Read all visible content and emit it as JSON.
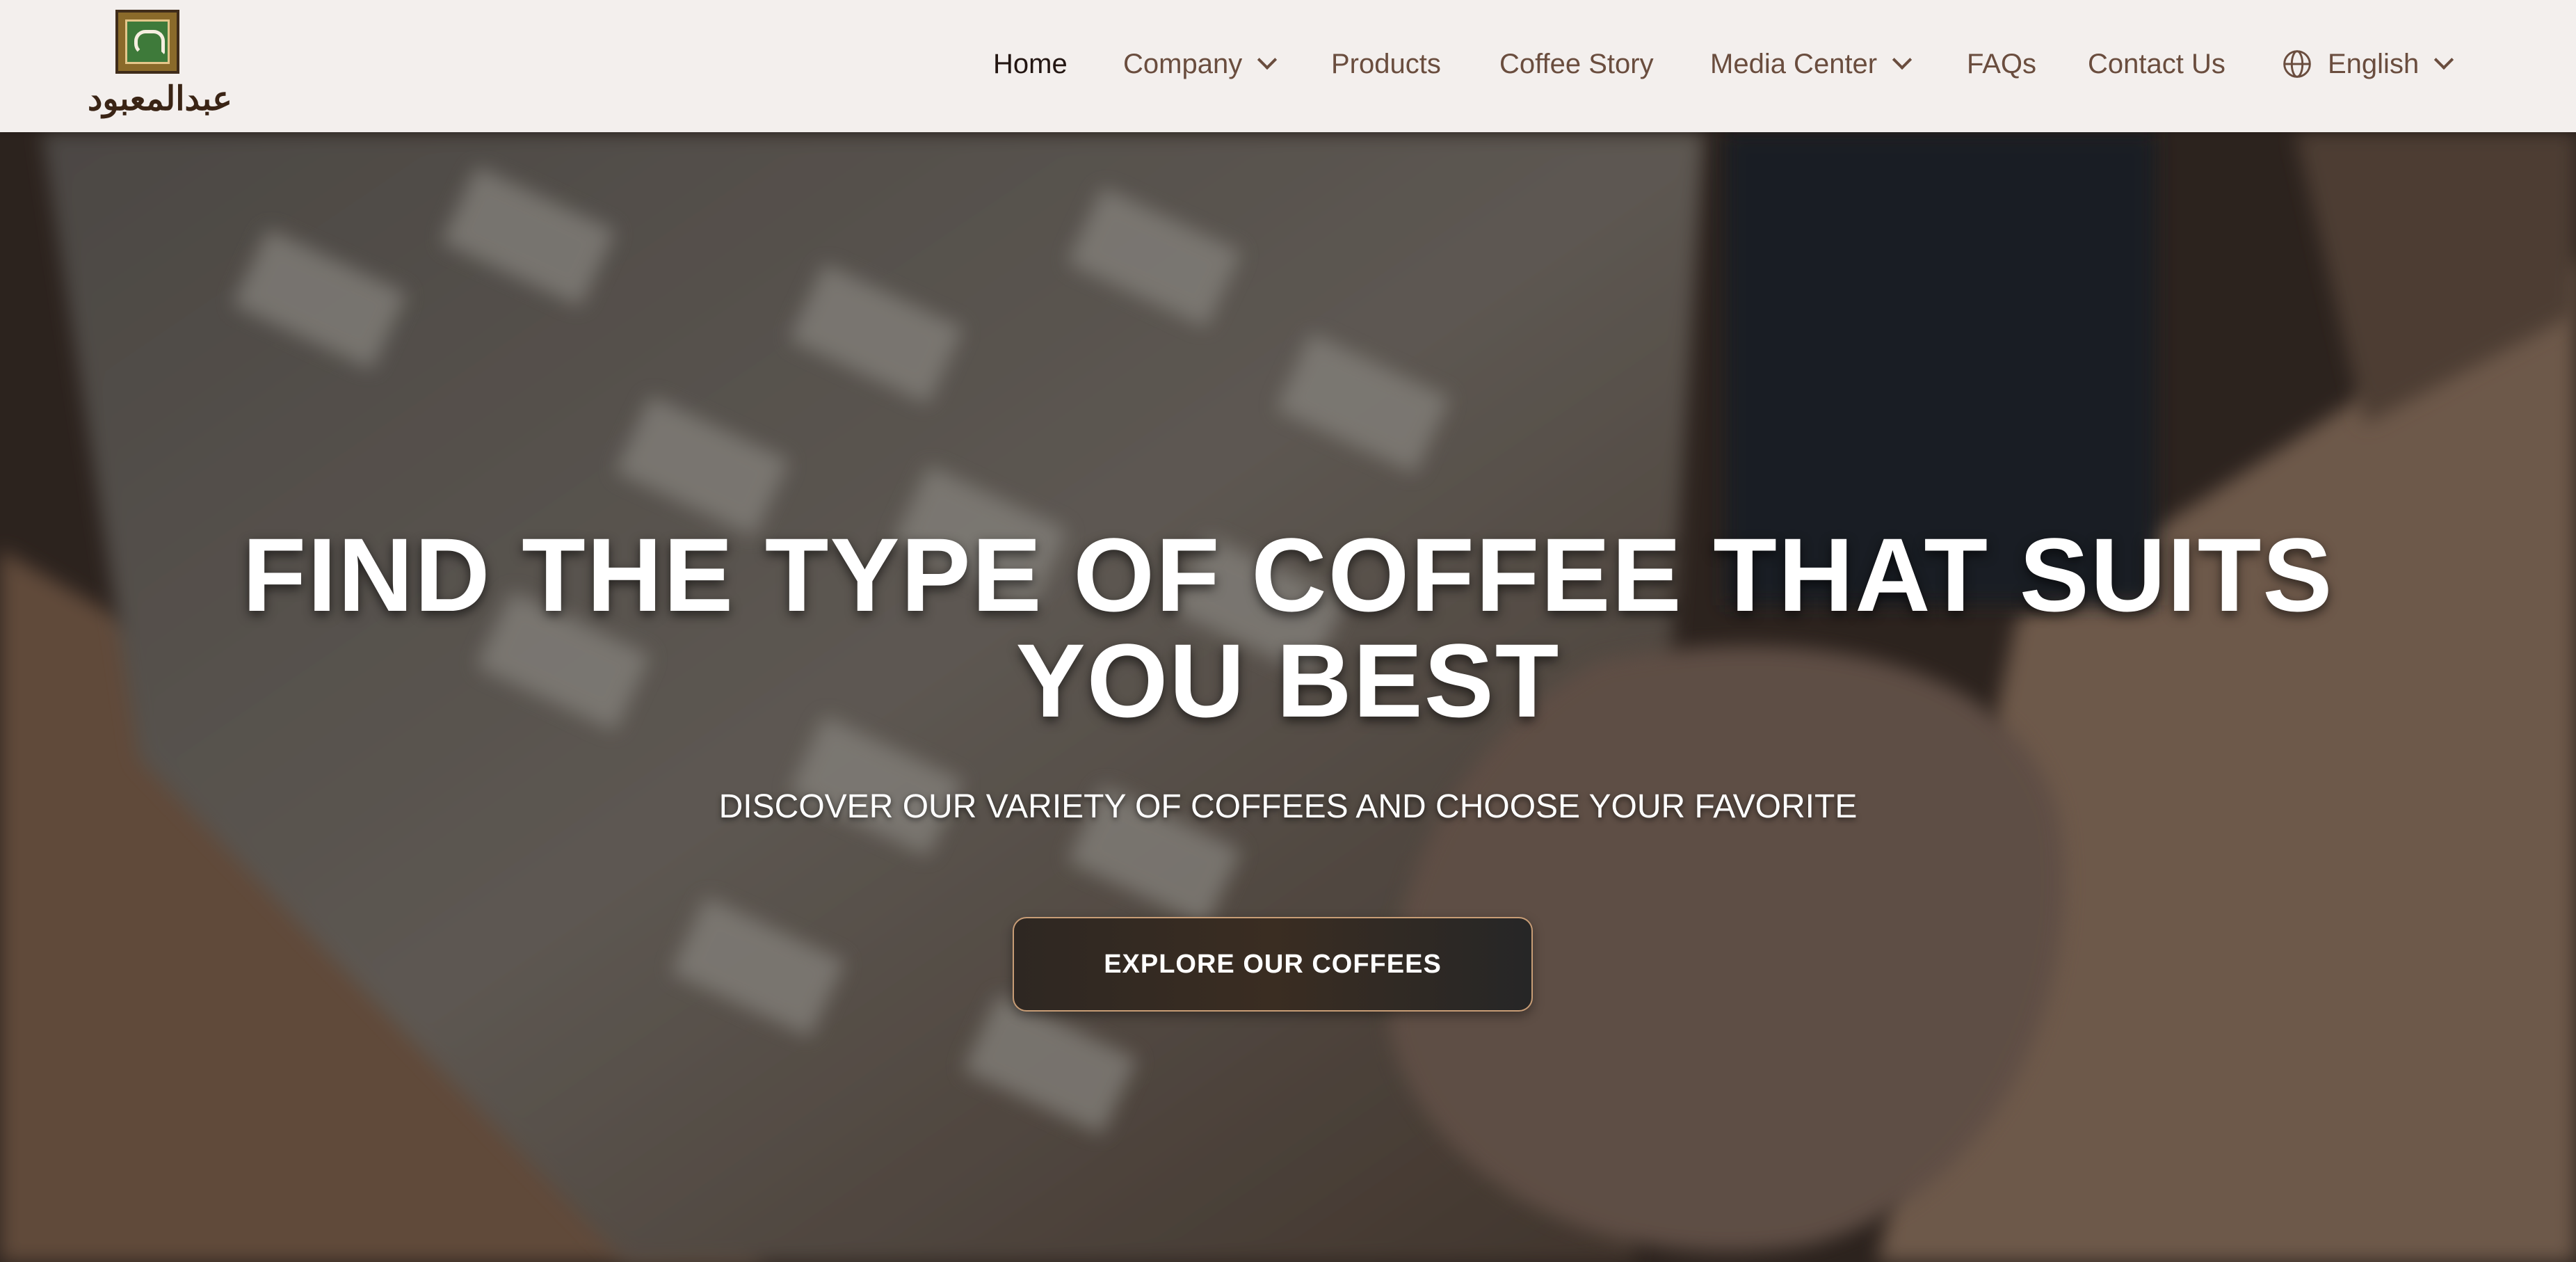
{
  "brand": {
    "logo_text": "عبدالمعبود"
  },
  "nav": {
    "items": [
      {
        "label": "Home",
        "active": true,
        "has_dropdown": false
      },
      {
        "label": "Company",
        "active": false,
        "has_dropdown": true
      },
      {
        "label": "Products",
        "active": false,
        "has_dropdown": false
      },
      {
        "label": "Coffee Story",
        "active": false,
        "has_dropdown": false
      },
      {
        "label": "Media Center",
        "active": false,
        "has_dropdown": true
      },
      {
        "label": "FAQs",
        "active": false,
        "has_dropdown": false
      },
      {
        "label": "Contact Us",
        "active": false,
        "has_dropdown": false
      }
    ],
    "language": {
      "label": "English",
      "icon": "globe-icon"
    }
  },
  "hero": {
    "title": "FIND THE TYPE OF COFFEE THAT SUITS YOU BEST",
    "subtitle": "DISCOVER OUR VARIETY OF COFFEES AND CHOOSE YOUR FAVORITE",
    "cta_label": "EXPLORE OUR COFFEES"
  },
  "colors": {
    "header_bg": "#f3efed",
    "nav_text": "#6a4d3e",
    "nav_active": "#231612",
    "cta_border": "#c89d76"
  }
}
